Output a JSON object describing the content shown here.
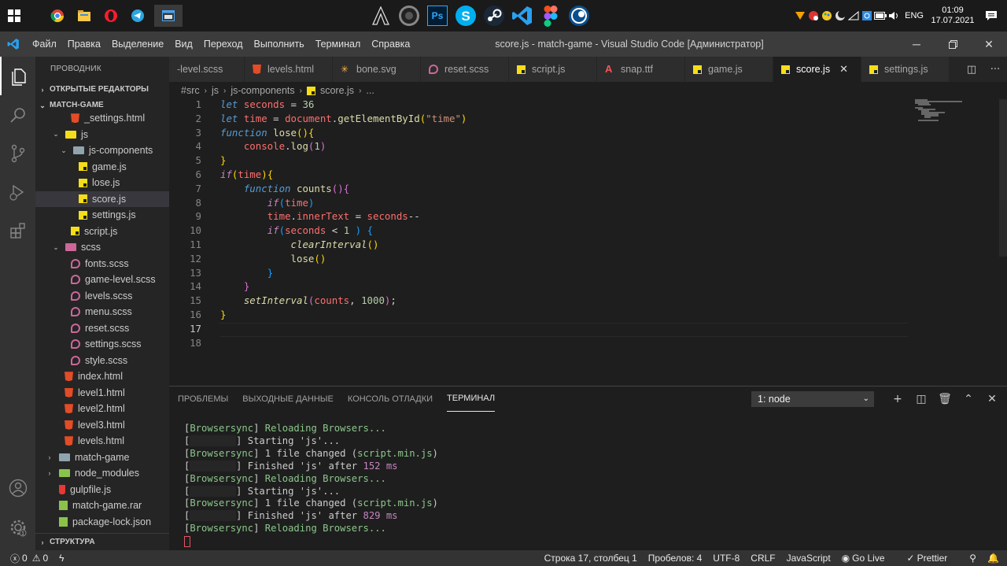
{
  "taskbar": {
    "apps_left": [
      "chrome-icon",
      "explorer-icon",
      "opera-icon",
      "telegram-icon",
      "window-app-icon"
    ],
    "apps_center": [
      "assassins-creed-icon",
      "speaker-app-icon",
      "photoshop-icon",
      "skype-icon",
      "steam-icon",
      "vscode-icon",
      "figma-icon",
      "cinema4d-icon"
    ],
    "photoshop_label": "Ps",
    "lang": "ENG",
    "time": "01:09",
    "date": "17.07.2021"
  },
  "titlebar": {
    "menu": [
      "Файл",
      "Правка",
      "Выделение",
      "Вид",
      "Переход",
      "Выполнить",
      "Терминал",
      "Справка"
    ],
    "title": "score.js - match-game - Visual Studio Code [Администратор]"
  },
  "sidebar": {
    "title": "ПРОВОДНИК",
    "open_editors": "ОТКРЫТЫЕ РЕДАКТОРЫ",
    "project": "MATCH-GAME",
    "structure": "СТРУКТУРА",
    "tree": [
      {
        "label": "_settings.html",
        "type": "html",
        "indent": 45,
        "twisty": ""
      },
      {
        "label": "js",
        "type": "folder-js",
        "indent": 20,
        "twisty": "⌄"
      },
      {
        "label": "js-components",
        "type": "folder-plain",
        "indent": 30,
        "twisty": "⌄"
      },
      {
        "label": "game.js",
        "type": "js",
        "indent": 55,
        "twisty": ""
      },
      {
        "label": "lose.js",
        "type": "js",
        "indent": 55,
        "twisty": ""
      },
      {
        "label": "score.js",
        "type": "js",
        "indent": 55,
        "twisty": "",
        "selected": true
      },
      {
        "label": "settings.js",
        "type": "js",
        "indent": 55,
        "twisty": ""
      },
      {
        "label": "script.js",
        "type": "js",
        "indent": 45,
        "twisty": ""
      },
      {
        "label": "scss",
        "type": "folder-scss",
        "indent": 20,
        "twisty": "⌄"
      },
      {
        "label": "fonts.scss",
        "type": "scss",
        "indent": 45,
        "twisty": ""
      },
      {
        "label": "game-level.scss",
        "type": "scss",
        "indent": 45,
        "twisty": ""
      },
      {
        "label": "levels.scss",
        "type": "scss",
        "indent": 45,
        "twisty": ""
      },
      {
        "label": "menu.scss",
        "type": "scss",
        "indent": 45,
        "twisty": ""
      },
      {
        "label": "reset.scss",
        "type": "scss",
        "indent": 45,
        "twisty": ""
      },
      {
        "label": "settings.scss",
        "type": "scss",
        "indent": 45,
        "twisty": ""
      },
      {
        "label": "style.scss",
        "type": "scss",
        "indent": 45,
        "twisty": ""
      },
      {
        "label": "index.html",
        "type": "html",
        "indent": 37,
        "twisty": ""
      },
      {
        "label": "level1.html",
        "type": "html",
        "indent": 37,
        "twisty": ""
      },
      {
        "label": "level2.html",
        "type": "html",
        "indent": 37,
        "twisty": ""
      },
      {
        "label": "level3.html",
        "type": "html",
        "indent": 37,
        "twisty": ""
      },
      {
        "label": "levels.html",
        "type": "html",
        "indent": 37,
        "twisty": ""
      },
      {
        "label": "match-game",
        "type": "folder-plain",
        "indent": 12,
        "twisty": "›"
      },
      {
        "label": "node_modules",
        "type": "folder-node",
        "indent": 12,
        "twisty": "›"
      },
      {
        "label": "gulpfile.js",
        "type": "gulp",
        "indent": 30,
        "twisty": ""
      },
      {
        "label": "match-game.rar",
        "type": "rar",
        "indent": 30,
        "twisty": ""
      },
      {
        "label": "package-lock.json",
        "type": "rar",
        "indent": 30,
        "twisty": ""
      }
    ]
  },
  "tabs": [
    {
      "label": "-level.scss",
      "type": "scss-none"
    },
    {
      "label": "levels.html",
      "type": "html"
    },
    {
      "label": "bone.svg",
      "type": "svg"
    },
    {
      "label": "reset.scss",
      "type": "scss"
    },
    {
      "label": "script.js",
      "type": "js"
    },
    {
      "label": "snap.ttf",
      "type": "ttf"
    },
    {
      "label": "game.js",
      "type": "js"
    },
    {
      "label": "score.js",
      "type": "js",
      "active": true
    },
    {
      "label": "settings.js",
      "type": "js"
    }
  ],
  "breadcrumb": [
    "#src",
    "js",
    "js-components",
    "score.js",
    "..."
  ],
  "editor": {
    "line_numbers": [
      "1",
      "2",
      "3",
      "4",
      "5",
      "6",
      "7",
      "8",
      "9",
      "10",
      "11",
      "12",
      "13",
      "14",
      "15",
      "16",
      "17",
      "18"
    ],
    "current_line": 17
  },
  "panel": {
    "tabs": [
      "ПРОБЛЕМЫ",
      "ВЫХОДНЫЕ ДАННЫЕ",
      "КОНСОЛЬ ОТЛАДКИ",
      "ТЕРМИНАЛ"
    ],
    "active_tab": "ТЕРМИНАЛ",
    "terminal_select": "1: node",
    "terminal_lines": [
      {
        "kind": "bs",
        "text": "Reloading Browsers..."
      },
      {
        "kind": "task",
        "text": "Starting 'js'..."
      },
      {
        "kind": "bs-change",
        "pre": "1 file changed (",
        "file": "script.min.js",
        "post": ")"
      },
      {
        "kind": "finish",
        "pre": "Finished 'js' after ",
        "num": "152",
        "unit": " ms"
      },
      {
        "kind": "bs",
        "text": "Reloading Browsers..."
      },
      {
        "kind": "task",
        "text": "Starting 'js'..."
      },
      {
        "kind": "bs-change",
        "pre": "1 file changed (",
        "file": "script.min.js",
        "post": ")"
      },
      {
        "kind": "finish",
        "pre": "Finished 'js' after ",
        "num": "829",
        "unit": " ms"
      },
      {
        "kind": "bs",
        "text": "Reloading Browsers..."
      }
    ],
    "bs_tag": "Browsersync"
  },
  "statusbar": {
    "errors": "0",
    "warnings": "0",
    "position": "Строка 17, столбец 1",
    "spaces": "Пробелов: 4",
    "encoding": "UTF-8",
    "eol": "CRLF",
    "language": "JavaScript",
    "golive": "Go Live",
    "prettier": "Prettier"
  }
}
